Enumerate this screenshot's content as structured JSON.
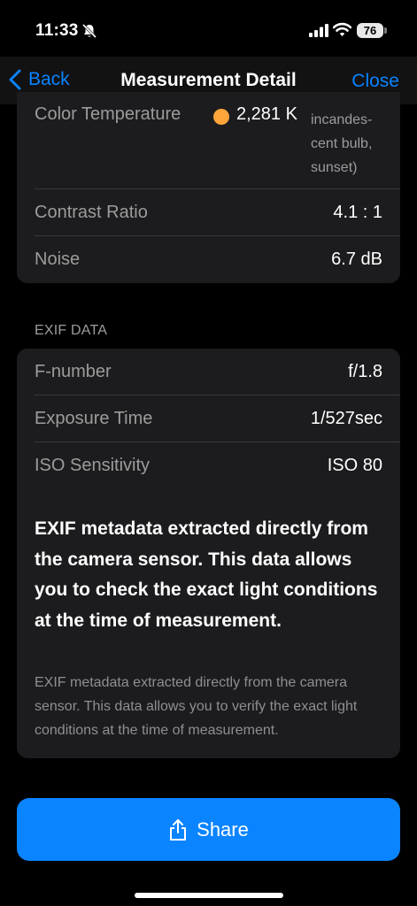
{
  "status_bar": {
    "time": "11:33",
    "battery": "76",
    "icons": [
      "bell-slash-icon",
      "signal-icon",
      "wifi-icon",
      "battery-icon"
    ]
  },
  "nav": {
    "back_label": "Back",
    "title": "Measurement Detail",
    "close_label": "Close"
  },
  "measurements": {
    "color_temperature": {
      "label": "Color Temperature",
      "value": "2,281 K",
      "note": "incandes-cent bulb, sunset)",
      "dot_color": "#ffa53a"
    },
    "contrast_ratio": {
      "label": "Contrast Ratio",
      "value": "4.1 : 1"
    },
    "noise": {
      "label": "Noise",
      "value": "6.7 dB"
    }
  },
  "exif": {
    "header": "EXIF DATA",
    "rows": [
      {
        "label": "F-number",
        "value": "f/1.8"
      },
      {
        "label": "Exposure Time",
        "value": "1/527sec"
      },
      {
        "label": "ISO Sensitivity",
        "value": "ISO 80"
      }
    ],
    "info_bold": "EXIF metadata extracted directly from the camera sensor. This data allows you to check the exact light conditions at the time of measurement.",
    "info_small": "EXIF metadata extracted directly from the camera sensor. This data allows you to verify the exact light conditions at the time of measurement."
  },
  "share": {
    "label": "Share",
    "icon": "share-icon"
  },
  "colors": {
    "accent": "#0a84ff",
    "card": "#1c1c1e",
    "background": "#000000"
  }
}
